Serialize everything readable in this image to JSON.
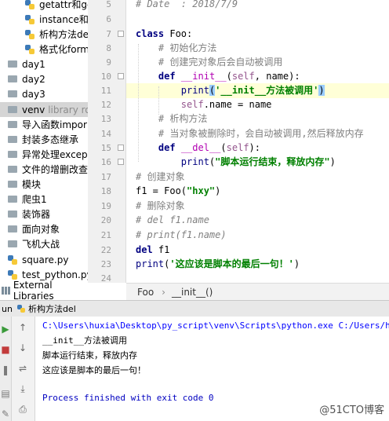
{
  "tree": {
    "items": [
      {
        "label": "getattr和ge",
        "kind": "py"
      },
      {
        "label": "instance和i",
        "kind": "py"
      },
      {
        "label": "析构方法de",
        "kind": "py"
      },
      {
        "label": "格式化form",
        "kind": "py"
      },
      {
        "label": "day1",
        "kind": "folder"
      },
      {
        "label": "day2",
        "kind": "folder"
      },
      {
        "label": "day3",
        "kind": "folder"
      },
      {
        "label": "venv",
        "kind": "folder",
        "hint": "library ro"
      },
      {
        "label": "导入函数impor",
        "kind": "folder"
      },
      {
        "label": "封装多态继承",
        "kind": "folder"
      },
      {
        "label": "异常处理excep",
        "kind": "folder"
      },
      {
        "label": "文件的增删改查",
        "kind": "folder"
      },
      {
        "label": "模块",
        "kind": "folder"
      },
      {
        "label": "爬虫1",
        "kind": "folder"
      },
      {
        "label": "装饰器",
        "kind": "folder"
      },
      {
        "label": "面向对象",
        "kind": "folder"
      },
      {
        "label": "飞机大战",
        "kind": "folder"
      },
      {
        "label": "square.py",
        "kind": "py"
      },
      {
        "label": "test_python.py",
        "kind": "py"
      }
    ],
    "external_libraries": "External Libraries"
  },
  "editor": {
    "line_numbers": [
      "5",
      "6",
      "7",
      "8",
      "9",
      "10",
      "11",
      "12",
      "13",
      "14",
      "15",
      "16",
      "17",
      "18",
      "19",
      "20",
      "21",
      "22",
      "23",
      "24"
    ],
    "current_line": "11"
  },
  "breadcrumb": {
    "class_name": "Foo",
    "separator": "›",
    "method_name": "__init__()"
  },
  "run": {
    "label": "un",
    "config_name": "析构方法del",
    "console": [
      "C:\\Users\\huxia\\Desktop\\py_script\\venv\\Scripts\\python.exe C:/Users/hux",
      "__init__方法被调用",
      "脚本运行结束，释放内存",
      "这应该是脚本的最后一句！",
      "",
      "Process finished with exit code 0"
    ]
  },
  "watermark": "@51CTO博客",
  "colors": {
    "keyword": "#000080",
    "string": "#008000",
    "comment": "#808080",
    "self": "#94558d",
    "console_path": "#0000ff",
    "current_line_bg": "#ffffd7"
  }
}
